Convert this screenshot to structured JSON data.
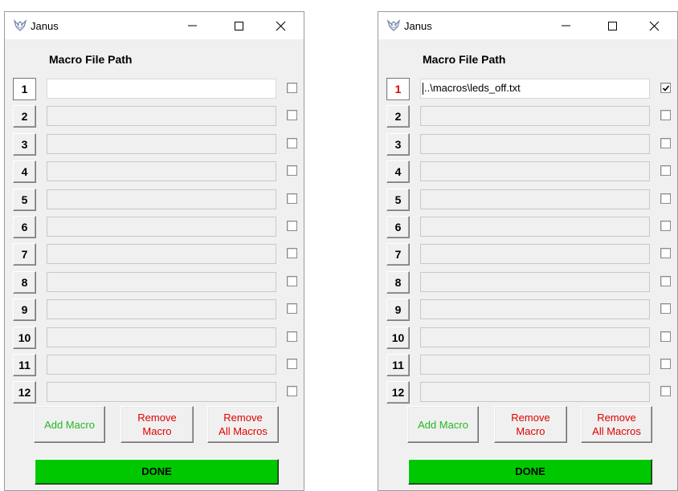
{
  "windows": [
    {
      "title": "Janus",
      "header": "Macro File Path",
      "rows": [
        {
          "num": "1",
          "path": "",
          "checked": false
        },
        {
          "num": "2",
          "path": "",
          "checked": false
        },
        {
          "num": "3",
          "path": "",
          "checked": false
        },
        {
          "num": "4",
          "path": "",
          "checked": false
        },
        {
          "num": "5",
          "path": "",
          "checked": false
        },
        {
          "num": "6",
          "path": "",
          "checked": false
        },
        {
          "num": "7",
          "path": "",
          "checked": false
        },
        {
          "num": "8",
          "path": "",
          "checked": false
        },
        {
          "num": "9",
          "path": "",
          "checked": false
        },
        {
          "num": "10",
          "path": "",
          "checked": false
        },
        {
          "num": "11",
          "path": "",
          "checked": false
        },
        {
          "num": "12",
          "path": "",
          "checked": false
        }
      ],
      "add_label": "Add Macro",
      "remove_label": "Remove\nMacro",
      "remove_all_label": "Remove\nAll Macros",
      "done_label": "DONE"
    },
    {
      "title": "Janus",
      "header": "Macro File Path",
      "rows": [
        {
          "num": "1",
          "path": "..\\macros\\leds_off.txt",
          "checked": true
        },
        {
          "num": "2",
          "path": "",
          "checked": false
        },
        {
          "num": "3",
          "path": "",
          "checked": false
        },
        {
          "num": "4",
          "path": "",
          "checked": false
        },
        {
          "num": "5",
          "path": "",
          "checked": false
        },
        {
          "num": "6",
          "path": "",
          "checked": false
        },
        {
          "num": "7",
          "path": "",
          "checked": false
        },
        {
          "num": "8",
          "path": "",
          "checked": false
        },
        {
          "num": "9",
          "path": "",
          "checked": false
        },
        {
          "num": "10",
          "path": "",
          "checked": false
        },
        {
          "num": "11",
          "path": "",
          "checked": false
        },
        {
          "num": "12",
          "path": "",
          "checked": false
        }
      ],
      "add_label": "Add Macro",
      "remove_label": "Remove\nMacro",
      "remove_all_label": "Remove\nAll Macros",
      "done_label": "DONE"
    }
  ],
  "colors": {
    "add": "#22b822",
    "remove": "#e00000",
    "done": "#00c800",
    "active_number": "#e00000"
  },
  "icons": {
    "app": "janus-app-icon",
    "minimize": "minimize-icon",
    "maximize": "maximize-icon",
    "close": "close-icon"
  }
}
